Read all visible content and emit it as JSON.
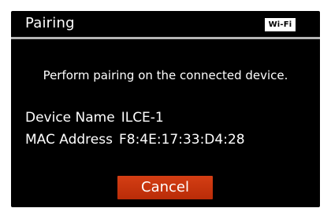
{
  "header": {
    "title": "Pairing",
    "wifi_badge": "Wi-Fi"
  },
  "message": "Perform pairing on the connected device.",
  "device": {
    "name_label": "Device Name",
    "name_value": "ILCE-1",
    "mac_label": "MAC Address",
    "mac_value": "F8:4E:17:33:D4:28"
  },
  "actions": {
    "cancel_label": "Cancel"
  },
  "colors": {
    "screen_background": "#000000",
    "accent_button": "#c93510",
    "divider": "#b5b5b5",
    "text": "#ffffff"
  }
}
